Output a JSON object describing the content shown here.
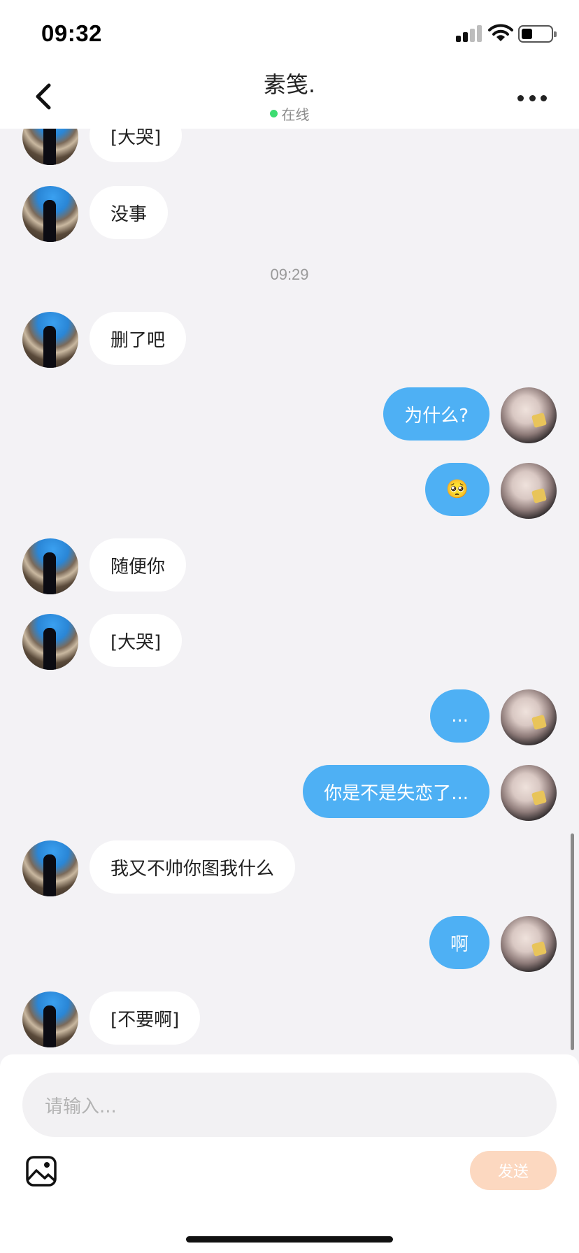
{
  "status": {
    "time": "09:32"
  },
  "header": {
    "title": "素笺.",
    "status": "在线"
  },
  "messages": [
    {
      "from": "them",
      "text": "[大哭]"
    },
    {
      "from": "them",
      "text": "没事"
    },
    {
      "type": "time",
      "text": "09:29"
    },
    {
      "from": "them",
      "text": "删了吧"
    },
    {
      "from": "me",
      "text": "为什么?"
    },
    {
      "from": "me",
      "text": "🥺"
    },
    {
      "from": "them",
      "text": "随便你"
    },
    {
      "from": "them",
      "text": "[大哭]"
    },
    {
      "from": "me",
      "text": "..."
    },
    {
      "from": "me",
      "text": "你是不是失恋了..."
    },
    {
      "from": "them",
      "text": "我又不帅你图我什么"
    },
    {
      "from": "me",
      "text": "啊"
    },
    {
      "from": "them",
      "text": "[不要啊]"
    }
  ],
  "composer": {
    "placeholder": "请输入...",
    "send_label": "发送"
  },
  "colors": {
    "accent": "#4eb0f4",
    "send_disabled": "#fcd8c0",
    "online": "#3ddc71"
  }
}
